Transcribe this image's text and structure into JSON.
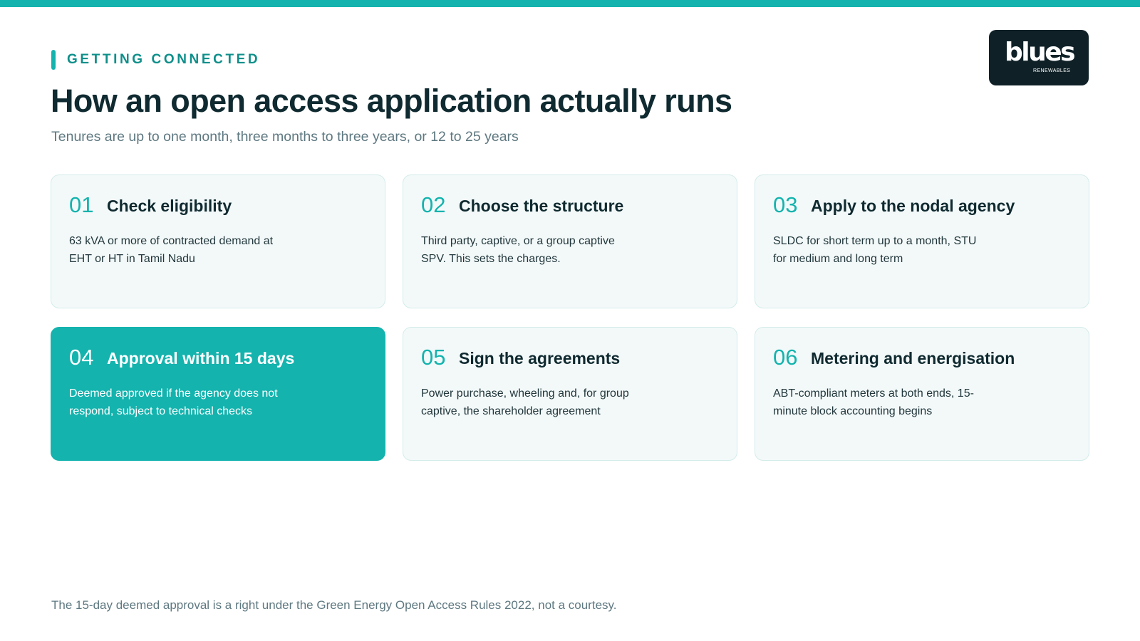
{
  "header": {
    "eyebrow": "GETTING CONNECTED",
    "title": "How an open access application actually runs",
    "subtitle": "Tenures are up to one month, three months to three years, or 12 to 25 years"
  },
  "logo": {
    "wordmark": "blues",
    "tagline": "RENEWABLES"
  },
  "steps": [
    {
      "number": "01",
      "title": "Check eligibility",
      "body": "63 kVA or more of contracted demand at EHT or HT in Tamil Nadu"
    },
    {
      "number": "02",
      "title": "Choose the structure",
      "body": "Third party, captive, or a group captive SPV. This sets the charges."
    },
    {
      "number": "03",
      "title": "Apply to the nodal agency",
      "body": "SLDC for short term up to a month, STU for medium and long term"
    },
    {
      "number": "04",
      "title": "Approval within 15 days",
      "body": "Deemed approved if the agency does not respond, subject to technical checks",
      "highlighted": true
    },
    {
      "number": "05",
      "title": "Sign the agreements",
      "body": "Power purchase, wheeling and, for group captive, the shareholder agreement"
    },
    {
      "number": "06",
      "title": "Metering and energisation",
      "body": "ABT-compliant meters at both ends, 15-minute block accounting begins"
    }
  ],
  "footnote": "The 15-day deemed approval is a right under the Green Energy Open Access Rules 2022, not a courtesy.",
  "colors": {
    "accent": "#14b3ae",
    "accent_dark": "#0d8f8a",
    "title_text": "#0f2a30",
    "muted_text": "#5e7880",
    "card_background": "#f3f9f9",
    "logo_background": "#0f2127"
  }
}
